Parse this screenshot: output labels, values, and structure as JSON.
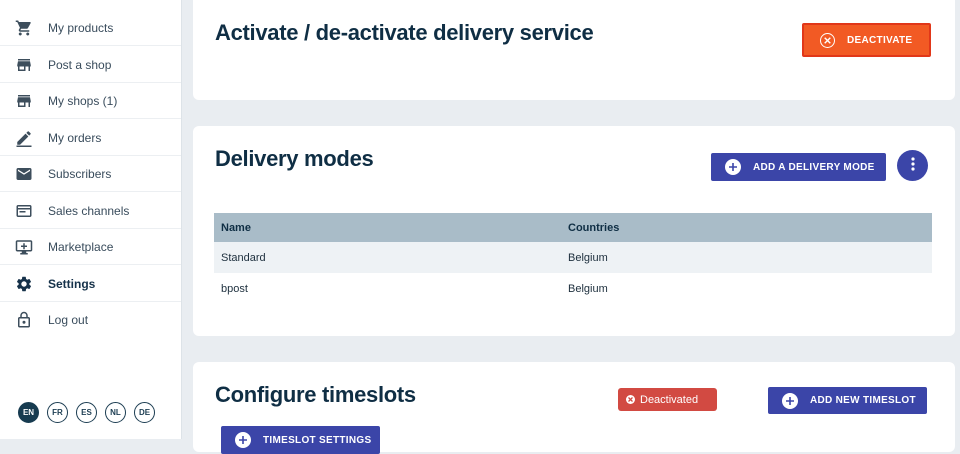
{
  "sidebar": {
    "items": [
      {
        "label": "My products",
        "icon": "cart-icon"
      },
      {
        "label": "Post a shop",
        "icon": "store-icon"
      },
      {
        "label": "My shops (1)",
        "icon": "store-icon"
      },
      {
        "label": "My orders",
        "icon": "pen-icon"
      },
      {
        "label": "Subscribers",
        "icon": "mail-icon"
      },
      {
        "label": "Sales channels",
        "icon": "browser-icon"
      },
      {
        "label": "Marketplace",
        "icon": "monitor-plus-icon"
      },
      {
        "label": "Settings",
        "icon": "gear-icon",
        "active": true
      },
      {
        "label": "Log out",
        "icon": "lock-icon"
      }
    ],
    "languages": [
      "EN",
      "FR",
      "ES",
      "NL",
      "DE"
    ],
    "active_language": "EN"
  },
  "activate": {
    "title": "Activate / de-activate delivery service",
    "deactivate_label": "DEACTIVATE"
  },
  "delivery": {
    "title": "Delivery modes",
    "add_label": "ADD A DELIVERY MODE",
    "columns": [
      "Name",
      "Countries"
    ],
    "rows": [
      {
        "name": "Standard",
        "countries": "Belgium"
      },
      {
        "name": "bpost",
        "countries": "Belgium"
      }
    ]
  },
  "timeslots": {
    "title": "Configure timeslots",
    "status_badge": "Deactivated",
    "add_label": "ADD NEW TIMESLOT",
    "settings_label": "TIMESLOT SETTINGS"
  },
  "colors": {
    "accent_blue": "#3b45a8",
    "deactivate_orange": "#f25a24",
    "status_red": "#d24a42",
    "navy": "#0f2e44"
  }
}
